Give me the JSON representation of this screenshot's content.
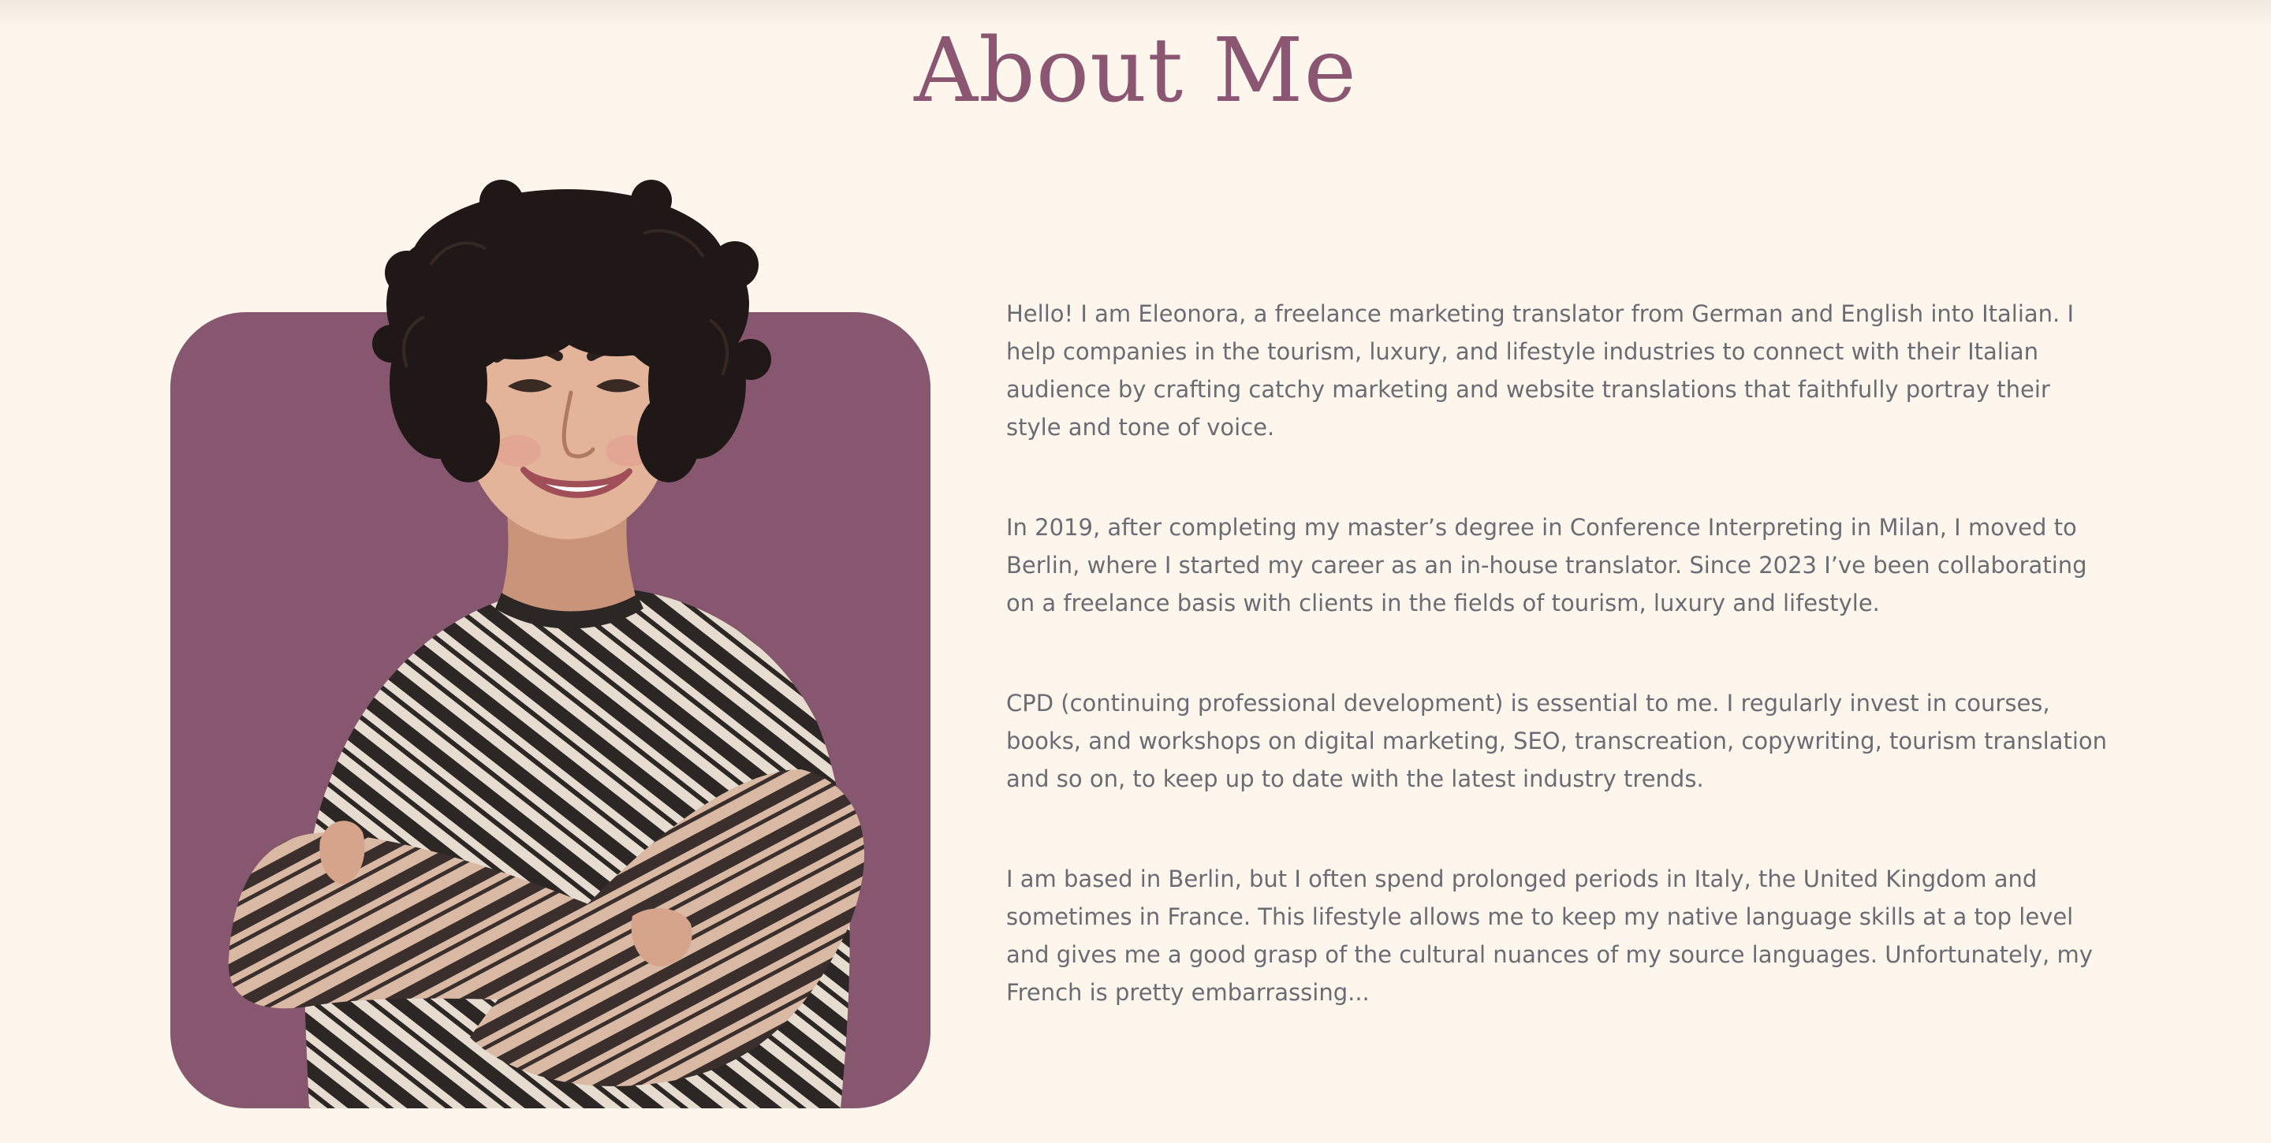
{
  "page": {
    "title": "About Me"
  },
  "portrait": {
    "accent_color": "#86576f",
    "alt": "Eleonora"
  },
  "bio": {
    "paragraphs": [
      "Hello! I am Eleonora, a freelance marketing translator from German and English into Italian. I help companies in the tourism, luxury, and lifestyle industries to connect with their Italian audience by crafting catchy marketing and website translations that faithfully portray their style and tone of voice.",
      "In 2019, after completing my master’s degree in Conference Interpreting in Milan, I moved to Berlin, where I started my career as an in-house translator. Since 2023 I’ve been collaborating on a freelance basis with clients in the fields of tourism, luxury and lifestyle.",
      "CPD (continuing professional development) is essential to me. I regularly invest in courses, books, and workshops on digital marketing, SEO, transcreation, copywriting, tourism translation and so on, to keep up to date with the latest industry trends.",
      "I am based in Berlin, but I often spend prolonged periods in Italy, the United Kingdom and sometimes in France. This lifestyle allows me to keep my native language skills at a top level and gives me a good grasp of the cultural nuances of my source languages. Unfortunately, my French is pretty embarrassing..."
    ]
  },
  "colors": {
    "background": "#fcf6ec",
    "title": "#8a5672",
    "text": "#6b6b73",
    "accent": "#86576f"
  }
}
